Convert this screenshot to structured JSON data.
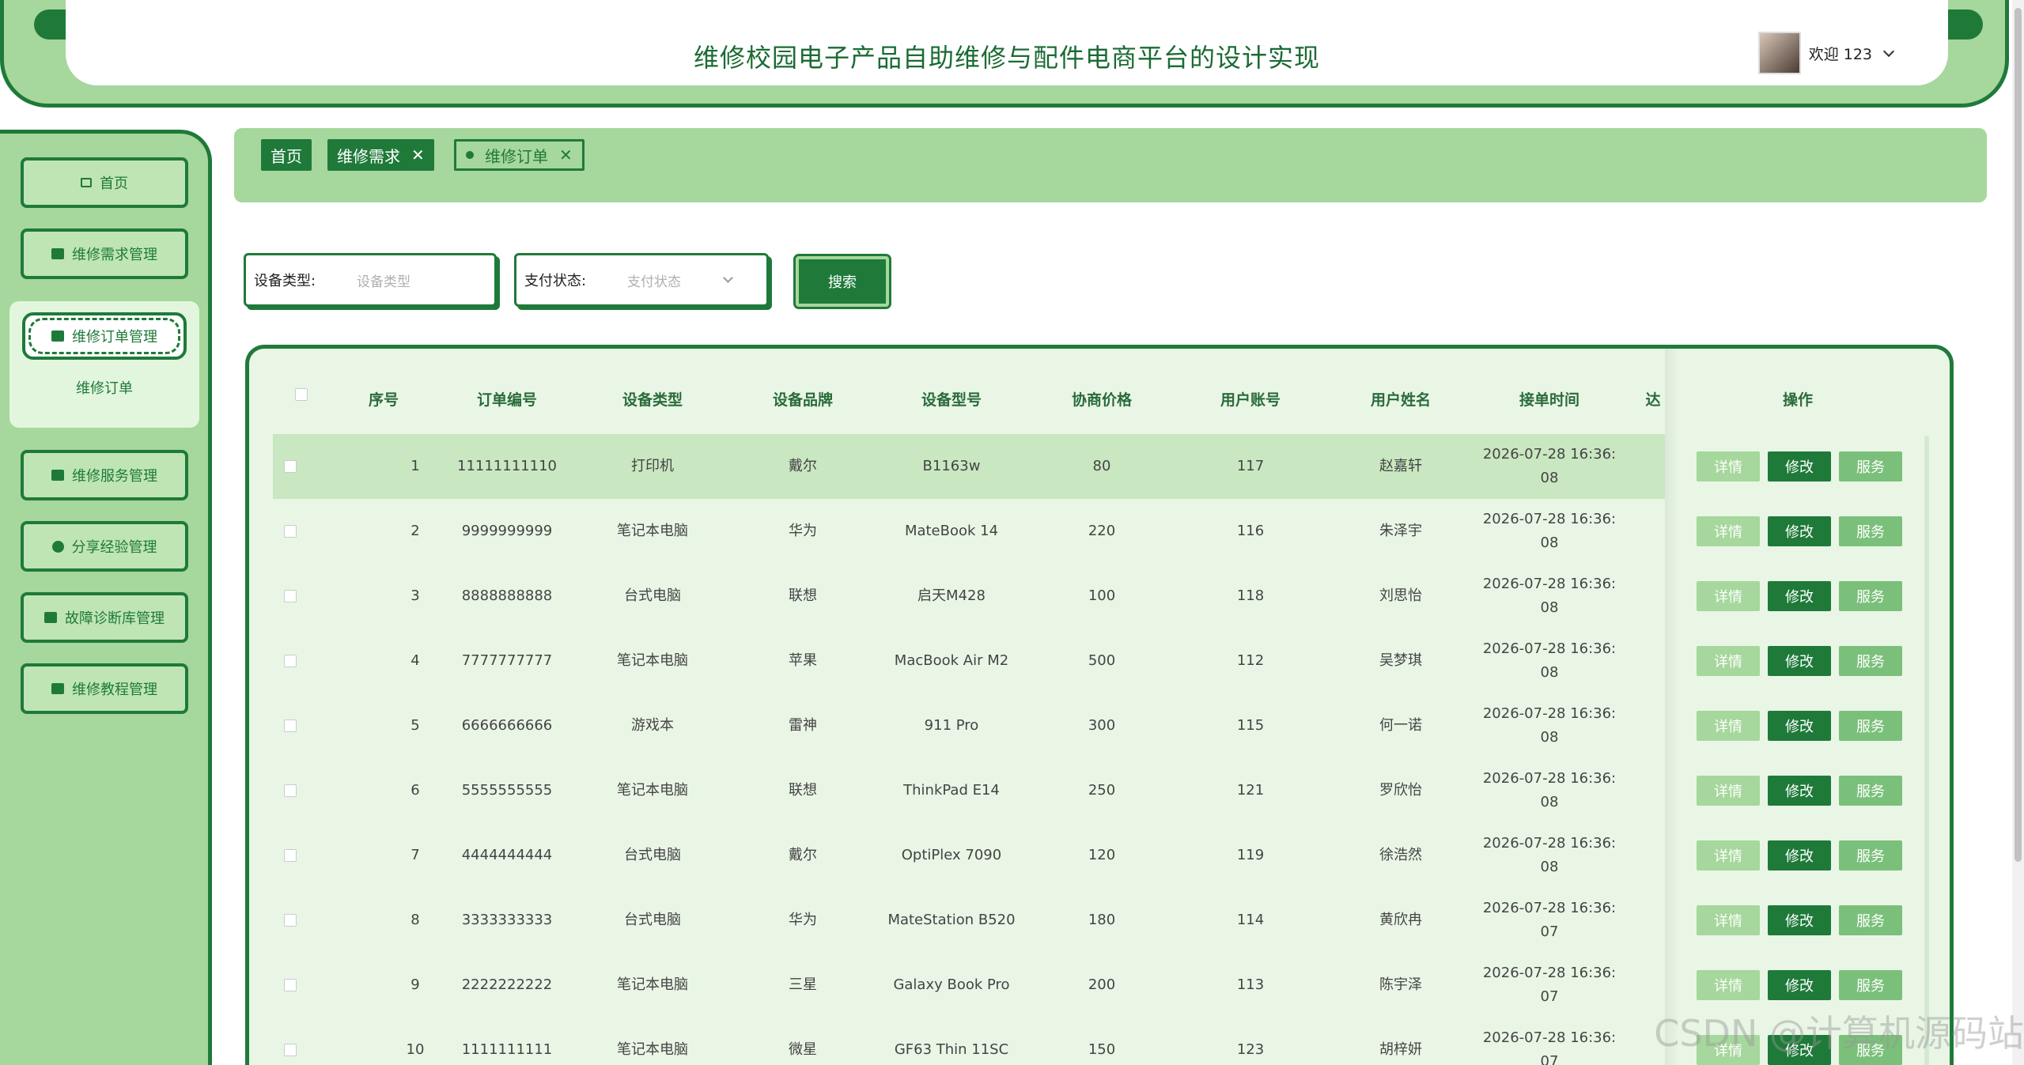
{
  "header": {
    "title": "维修校园电子产品自助维修与配件电商平台的设计实现",
    "welcome": "欢迎 123"
  },
  "sidebar": {
    "items": [
      {
        "label": "首页",
        "icon": "home-icon"
      },
      {
        "label": "维修需求管理",
        "icon": "chip-icon"
      },
      {
        "label": "维修订单管理",
        "icon": "order-icon"
      },
      {
        "label": "维修服务管理",
        "icon": "folder-icon"
      },
      {
        "label": "分享经验管理",
        "icon": "check-circle-icon"
      },
      {
        "label": "故障诊断库管理",
        "icon": "order-icon"
      },
      {
        "label": "维修教程管理",
        "icon": "book-icon"
      }
    ],
    "sub_item": "维修订单"
  },
  "tabs": [
    {
      "label": "首页"
    },
    {
      "label": "维修需求"
    },
    {
      "label": "维修订单"
    }
  ],
  "search": {
    "device_type_label": "设备类型:",
    "device_type_placeholder": "设备类型",
    "pay_status_label": "支付状态:",
    "pay_status_placeholder": "支付状态",
    "button": "搜索"
  },
  "table": {
    "headers": [
      "序号",
      "订单编号",
      "设备类型",
      "设备品牌",
      "设备型号",
      "协商价格",
      "用户账号",
      "用户姓名",
      "接单时间",
      "达",
      "操作"
    ],
    "rows": [
      [
        "1",
        "11111111110",
        "打印机",
        "戴尔",
        "B1163w",
        "80",
        "117",
        "赵嘉轩",
        "2026-07-28 16:36:",
        "08"
      ],
      [
        "2",
        "9999999999",
        "笔记本电脑",
        "华为",
        "MateBook 14",
        "220",
        "116",
        "朱泽宇",
        "2026-07-28 16:36:",
        "08"
      ],
      [
        "3",
        "8888888888",
        "台式电脑",
        "联想",
        "启天M428",
        "100",
        "118",
        "刘思怡",
        "2026-07-28 16:36:",
        "08"
      ],
      [
        "4",
        "7777777777",
        "笔记本电脑",
        "苹果",
        "MacBook Air M2",
        "500",
        "112",
        "吴梦琪",
        "2026-07-28 16:36:",
        "08"
      ],
      [
        "5",
        "6666666666",
        "游戏本",
        "雷神",
        "911 Pro",
        "300",
        "115",
        "何一诺",
        "2026-07-28 16:36:",
        "08"
      ],
      [
        "6",
        "5555555555",
        "笔记本电脑",
        "联想",
        "ThinkPad E14",
        "250",
        "121",
        "罗欣怡",
        "2026-07-28 16:36:",
        "08"
      ],
      [
        "7",
        "4444444444",
        "台式电脑",
        "戴尔",
        "OptiPlex 7090",
        "120",
        "119",
        "徐浩然",
        "2026-07-28 16:36:",
        "08"
      ],
      [
        "8",
        "3333333333",
        "台式电脑",
        "华为",
        "MateStation B520",
        "180",
        "114",
        "黄欣冉",
        "2026-07-28 16:36:",
        "07"
      ],
      [
        "9",
        "2222222222",
        "笔记本电脑",
        "三星",
        "Galaxy Book Pro",
        "200",
        "113",
        "陈宇泽",
        "2026-07-28 16:36:",
        "07"
      ],
      [
        "10",
        "1111111111",
        "笔记本电脑",
        "微星",
        "GF63 Thin 11SC",
        "150",
        "123",
        "胡梓妍",
        "2026-07-28 16:36:",
        "07"
      ]
    ],
    "actions": {
      "detail": "详情",
      "edit": "修改",
      "service": "服务"
    }
  },
  "watermark": "CSDN @计算机源码站",
  "colors": {
    "primary": "#1f7a3a",
    "light": "#a6d79c",
    "table_bg": "#e9f6e6"
  }
}
